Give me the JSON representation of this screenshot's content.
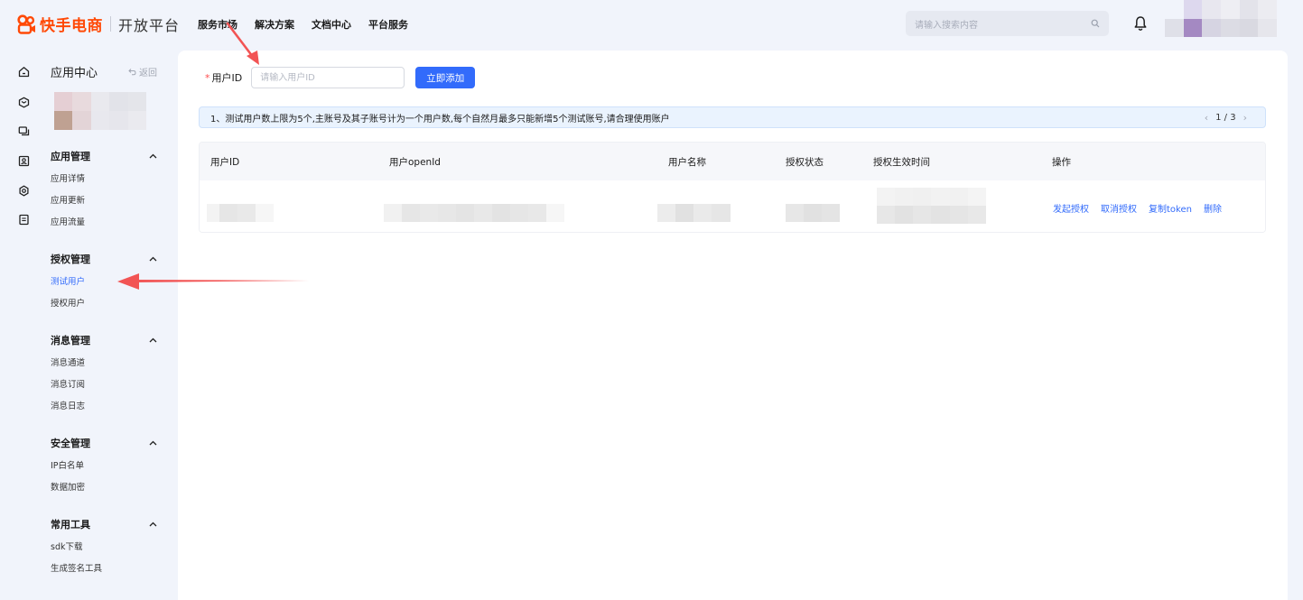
{
  "header": {
    "logo_text": "快手电商",
    "logo_sub": "开放平台",
    "nav": [
      "服务市场",
      "解决方案",
      "文档中心",
      "平台服务"
    ],
    "search_placeholder": "请输入搜索内容"
  },
  "sidebar": {
    "title": "应用中心",
    "back_label": "返回",
    "groups": [
      {
        "title": "应用管理",
        "items": [
          "应用详情",
          "应用更新",
          "应用流量"
        ]
      },
      {
        "title": "授权管理",
        "items": [
          "测试用户",
          "授权用户"
        ]
      },
      {
        "title": "消息管理",
        "items": [
          "消息通道",
          "消息订阅",
          "消息日志"
        ]
      },
      {
        "title": "安全管理",
        "items": [
          "IP白名单",
          "数据加密"
        ]
      },
      {
        "title": "常用工具",
        "items": [
          "sdk下载",
          "生成签名工具"
        ]
      }
    ],
    "active_item": "测试用户"
  },
  "main": {
    "form": {
      "required_mark": "*",
      "label": "用户ID",
      "input_placeholder": "请输入用户ID",
      "input_value": "",
      "add_button": "立即添加"
    },
    "notice": {
      "text": "1、测试用户数上限为5个,主账号及其子账号计为一个用户数,每个自然月最多只能新增5个测试账号,请合理使用账户",
      "pager": "1 / 3"
    },
    "table": {
      "columns": [
        "用户ID",
        "用户openId",
        "用户名称",
        "授权状态",
        "授权生效时间",
        "操作"
      ],
      "row_actions": [
        "发起授权",
        "取消授权",
        "复制token",
        "删除"
      ]
    }
  },
  "colors": {
    "brand": "#ff4906",
    "primary": "#326bfb",
    "notice_bg": "#eaf3fe",
    "annotation_arrow": "#f25454"
  }
}
